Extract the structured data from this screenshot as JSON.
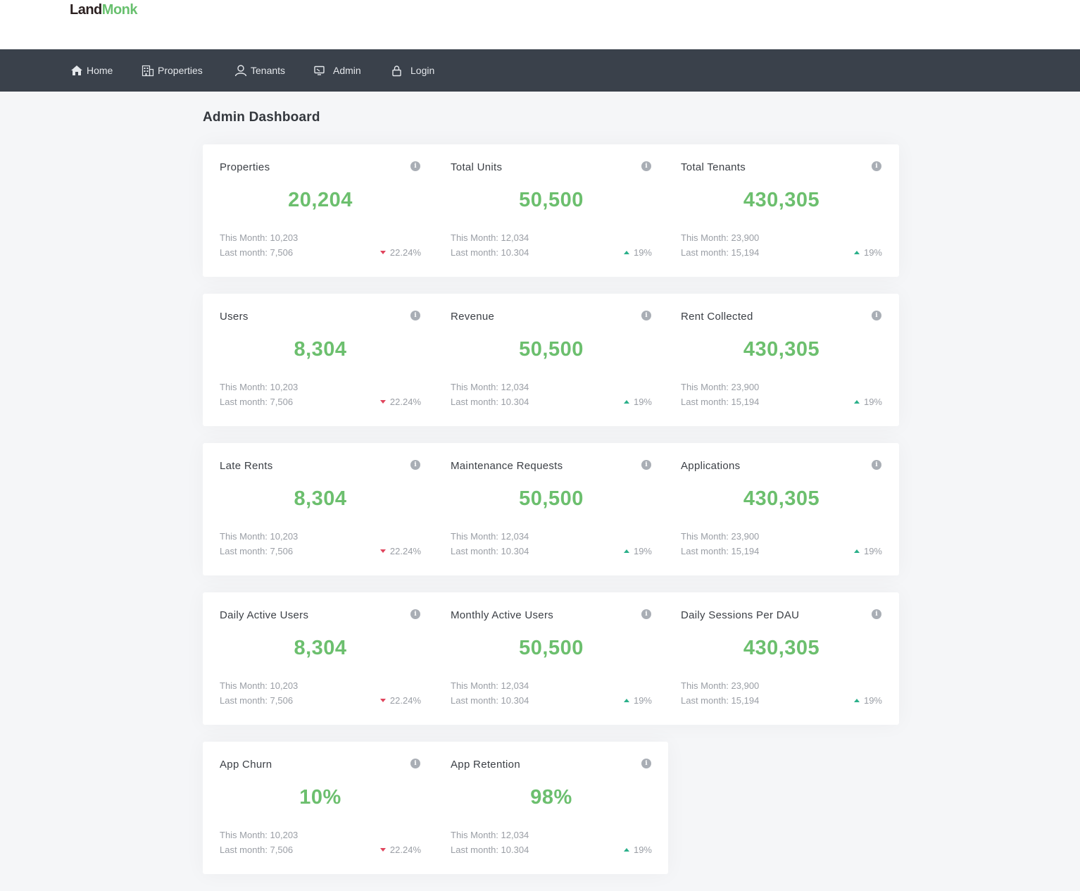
{
  "brand": {
    "part1": "Land",
    "part2": "Monk"
  },
  "nav": [
    {
      "label": "Home",
      "icon": "home-icon"
    },
    {
      "label": "Properties",
      "icon": "building-icon"
    },
    {
      "label": "Tenants",
      "icon": "user-icon"
    },
    {
      "label": "Admin",
      "icon": "monitor-icon"
    },
    {
      "label": "Login",
      "icon": "lock-icon"
    }
  ],
  "page_title": "Admin Dashboard",
  "colors": {
    "value_green": "#6cbf6e",
    "trend_down": "#e0445c",
    "trend_up": "#2bb08a",
    "navbar": "#3a414b"
  },
  "rows": [
    [
      {
        "title": "Properties",
        "value": "20,204",
        "this_month": "This Month: 10,203",
        "last_month": "Last month: 7,506",
        "change": "22.24%",
        "trend": "down"
      },
      {
        "title": "Total Units",
        "value": "50,500",
        "this_month": "This Month: 12,034",
        "last_month": "Last month: 10.304",
        "change": "19%",
        "trend": "up"
      },
      {
        "title": "Total Tenants",
        "value": "430,305",
        "this_month": "This Month: 23,900",
        "last_month": "Last month: 15,194",
        "change": "19%",
        "trend": "up"
      }
    ],
    [
      {
        "title": "Users",
        "value": "8,304",
        "this_month": "This Month: 10,203",
        "last_month": "Last month: 7,506",
        "change": "22.24%",
        "trend": "down"
      },
      {
        "title": "Revenue",
        "value": "50,500",
        "this_month": "This Month: 12,034",
        "last_month": "Last month: 10.304",
        "change": "19%",
        "trend": "up"
      },
      {
        "title": "Rent Collected",
        "value": "430,305",
        "this_month": "This Month: 23,900",
        "last_month": "Last month: 15,194",
        "change": "19%",
        "trend": "up"
      }
    ],
    [
      {
        "title": "Late Rents",
        "value": "8,304",
        "this_month": "This Month: 10,203",
        "last_month": "Last month: 7,506",
        "change": "22.24%",
        "trend": "down"
      },
      {
        "title": "Maintenance Requests",
        "value": "50,500",
        "this_month": "This Month: 12,034",
        "last_month": "Last month: 10.304",
        "change": "19%",
        "trend": "up"
      },
      {
        "title": "Applications",
        "value": "430,305",
        "this_month": "This Month: 23,900",
        "last_month": "Last month: 15,194",
        "change": "19%",
        "trend": "up"
      }
    ],
    [
      {
        "title": "Daily Active Users",
        "value": "8,304",
        "this_month": "This Month: 10,203",
        "last_month": "Last month: 7,506",
        "change": "22.24%",
        "trend": "down"
      },
      {
        "title": "Monthly Active Users",
        "value": "50,500",
        "this_month": "This Month: 12,034",
        "last_month": "Last month: 10.304",
        "change": "19%",
        "trend": "up"
      },
      {
        "title": "Daily Sessions Per DAU",
        "value": "430,305",
        "this_month": "This Month: 23,900",
        "last_month": "Last month: 15,194",
        "change": "19%",
        "trend": "up"
      }
    ],
    [
      {
        "title": "App Churn",
        "value": "10%",
        "this_month": "This Month: 10,203",
        "last_month": "Last month: 7,506",
        "change": "22.24%",
        "trend": "down"
      },
      {
        "title": "App Retention",
        "value": "98%",
        "this_month": "This Month: 12,034",
        "last_month": "Last month: 10.304",
        "change": "19%",
        "trend": "up"
      }
    ]
  ]
}
